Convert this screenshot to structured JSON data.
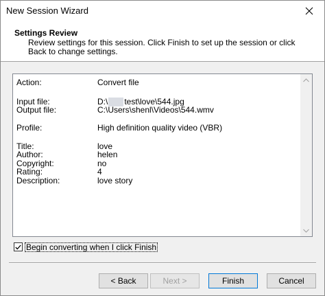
{
  "window": {
    "title": "New Session Wizard"
  },
  "header": {
    "title": "Settings Review",
    "description": "Review settings for this session. Click Finish to set up the session or click Back to change settings."
  },
  "summary": {
    "action_label": "Action:",
    "action_value": "Convert file",
    "input_label": "Input file:",
    "input_value_prefix": "D:\\",
    "input_value_suffix": "test\\love\\544.jpg",
    "output_label": "Output file:",
    "output_value": "C:\\Users\\shenl\\Videos\\544.wmv",
    "profile_label": "Profile:",
    "profile_value": "High definition quality video (VBR)",
    "title_label": "Title:",
    "title_value": "love",
    "author_label": "Author:",
    "author_value": "helen",
    "copyright_label": "Copyright:",
    "copyright_value": "no",
    "rating_label": "Rating:",
    "rating_value": "4",
    "description_label": "Description:",
    "description_value": "love story"
  },
  "options": {
    "begin_converting_label": "Begin converting when I click Finish",
    "begin_converting_checked": true
  },
  "buttons": {
    "back": "< Back",
    "next": "Next >",
    "finish": "Finish",
    "cancel": "Cancel"
  },
  "icons": {
    "close": "close-icon",
    "scroll_up": "scroll-up-arrow-icon",
    "scroll_down": "scroll-down-arrow-icon",
    "check": "checkmark-icon"
  }
}
